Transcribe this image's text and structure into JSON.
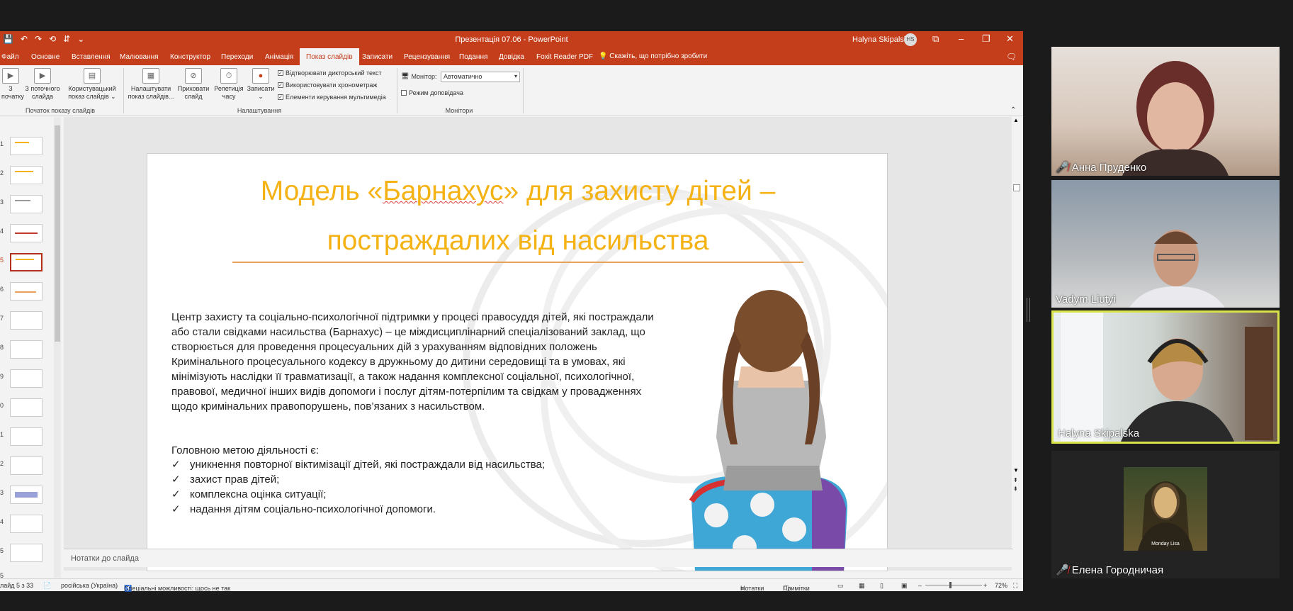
{
  "window": {
    "title": "Презентація 07.06  -  PowerPoint",
    "user": "Halyna Skipalska",
    "user_initials": "HS",
    "quick_access": [
      "💾",
      "↶",
      "↷",
      "⟲",
      "⇵",
      "⌄"
    ],
    "controls": {
      "minimize": "–",
      "restore": "❐",
      "close": "✕",
      "layout": "⧉"
    }
  },
  "menu": {
    "tabs": [
      "Файл",
      "Основне",
      "Вставлення",
      "Малювання",
      "Конструктор",
      "Переходи",
      "Анімація",
      "Показ слайдів",
      "Записати",
      "Рецензування",
      "Подання",
      "Довідка",
      "Foxit Reader PDF"
    ],
    "tell_me": "Скажіть, що потрібно зробити"
  },
  "ribbon": {
    "from_start": "З\nпочатку",
    "from_current": "З поточного\nслайда",
    "custom_show": "Користувацький\nпоказ слайдів ⌄",
    "group_start": "Початок показу слайдів",
    "setup_show": "Налаштувати\nпоказ слайдів...",
    "hide_slide": "Приховати\nслайд",
    "rehearse": "Репетиція\nчасу",
    "record": "Записати\n⌄",
    "cb_narration": "Відтворювати дикторський текст",
    "cb_timings": "Використовувати хронометраж",
    "cb_media": "Елементи керування мультимедіа",
    "group_setup": "Налаштування",
    "monitor_label": "Монітор:",
    "monitor_value": "Автоматично",
    "presenter_view": "Режим доповідача",
    "group_monitors": "Монітори"
  },
  "thumbnails": {
    "numbers": [
      "1",
      "2",
      "3",
      "4",
      "5",
      "6",
      "7",
      "8",
      "9",
      "0",
      "1",
      "2",
      "3",
      "4",
      "5",
      "5"
    ],
    "selected_index": 4
  },
  "slide": {
    "title_part1": "Модель «",
    "title_word": "Барнахус",
    "title_part2": "» для захисту дітей –",
    "title_line2": "постраждалих від насильства",
    "body": "Центр захисту та соціально-психологічної підтримки у процесі правосуддя дітей, які постраждали або стали свідками насильства (Барнахус) – це міждисциплінарний спеціалізований заклад, що створюється для проведення процесуальних дій з урахуванням відповідних положень Кримінального процесуального кодексу в дружньому до дитини середовищі та в умовах, які мінімізують наслідки її травматизації, а також надання комплексної соціальної, психологічної, правової, медичної інших видів допомоги і послуг дітям-потерпілим та свідкам у провадженнях щодо кримінальних правопорушень, пов’язаних з насильством.",
    "goal": "Головною метою діяльності є:",
    "check": "✓",
    "bullets": [
      "уникнення повторної віктимізації дітей, які постраждали від насильства;",
      "захист прав дітей;",
      "комплексна оцінка ситуації;",
      "надання дітям соціально-психологічної допомоги."
    ]
  },
  "notes_placeholder": "Нотатки до слайда",
  "status": {
    "slide_info": "лайд 5 з 33",
    "language": "російська (Україна)",
    "accessibility": "Спеціальні можливості: щось не так",
    "notes": "Нотатки",
    "comments": "Примітки",
    "zoom": "72%"
  },
  "participants": [
    {
      "name": "Анна Пруденко",
      "muted": true
    },
    {
      "name": "Vadym Liutyi",
      "muted": false
    },
    {
      "name": "Halyna Skipalska",
      "muted": false,
      "speaking": true
    },
    {
      "name": "Елена Городничая",
      "muted": true,
      "avatar_caption": "Monday Lisa"
    }
  ]
}
